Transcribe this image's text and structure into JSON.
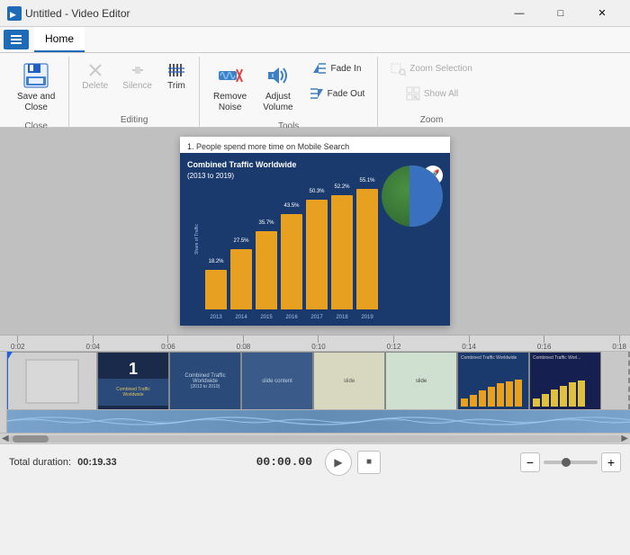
{
  "window": {
    "title": "Untitled - Video Editor",
    "icon": "🎬"
  },
  "title_bar": {
    "minimize": "—",
    "maximize": "□",
    "close": "✕"
  },
  "ribbon": {
    "tab_icon": "≡",
    "tabs": [
      {
        "id": "home",
        "label": "Home",
        "active": true
      }
    ],
    "groups": [
      {
        "id": "close",
        "label": "Close",
        "items": [
          {
            "id": "save-close",
            "label": "Save and\nClose",
            "type": "large",
            "icon": "💾"
          }
        ]
      },
      {
        "id": "editing",
        "label": "Editing",
        "items": [
          {
            "id": "delete",
            "label": "Delete",
            "type": "small",
            "icon": "✕",
            "disabled": true
          },
          {
            "id": "silence",
            "label": "Silence",
            "type": "small",
            "icon": "—",
            "disabled": true
          },
          {
            "id": "trim",
            "label": "Trim",
            "type": "small",
            "icon": "✂",
            "disabled": false
          }
        ]
      },
      {
        "id": "tools",
        "label": "Tools",
        "items": [
          {
            "id": "remove-noise",
            "label": "Remove\nNoise",
            "type": "large",
            "icon": "🔇"
          },
          {
            "id": "adjust-volume",
            "label": "Adjust\nVolume",
            "type": "large",
            "icon": "🔊"
          },
          {
            "id": "fade-in",
            "label": "Fade In",
            "type": "small-right"
          },
          {
            "id": "fade-out",
            "label": "Fade Out",
            "type": "small-right"
          }
        ]
      },
      {
        "id": "zoom",
        "label": "Zoom",
        "items": [
          {
            "id": "zoom-selection",
            "label": "Zoom Selection",
            "type": "small-top",
            "disabled": true
          },
          {
            "id": "show-all",
            "label": "Show All",
            "type": "small-top",
            "disabled": true
          }
        ]
      }
    ]
  },
  "preview": {
    "slide_title": "1. People spend more time on Mobile Search",
    "chart_title": "Combined Traffic Worldwide\n(2013 to 2019)",
    "bars": [
      {
        "year": "2013",
        "value": 18.2,
        "label": "18.2%"
      },
      {
        "year": "2014",
        "value": 27.5,
        "label": "27.5%"
      },
      {
        "year": "2015",
        "value": 35.7,
        "label": "35.7%"
      },
      {
        "year": "2016",
        "value": 43.5,
        "label": "43.5%"
      },
      {
        "year": "2017",
        "value": 50.3,
        "label": "50.3%"
      },
      {
        "year": "2018",
        "value": 52.2,
        "label": "52.2%"
      },
      {
        "year": "2019",
        "value": 55.1,
        "label": "55.1%"
      }
    ],
    "y_axis_label": "Share of Traffic",
    "rocket_emoji": "🚀"
  },
  "timeline": {
    "ruler_marks": [
      "0:02",
      "0:04",
      "0:06",
      "0:08",
      "0:10",
      "0:12",
      "0:14",
      "0:16",
      "0:18"
    ],
    "clip_count": 9
  },
  "bottom_bar": {
    "duration_prefix": "Total duration:",
    "duration_value": "00:19.33",
    "timecode": "00:00.00",
    "play_icon": "▶",
    "stop_icon": "■",
    "zoom_minus": "−",
    "zoom_plus": "+"
  }
}
